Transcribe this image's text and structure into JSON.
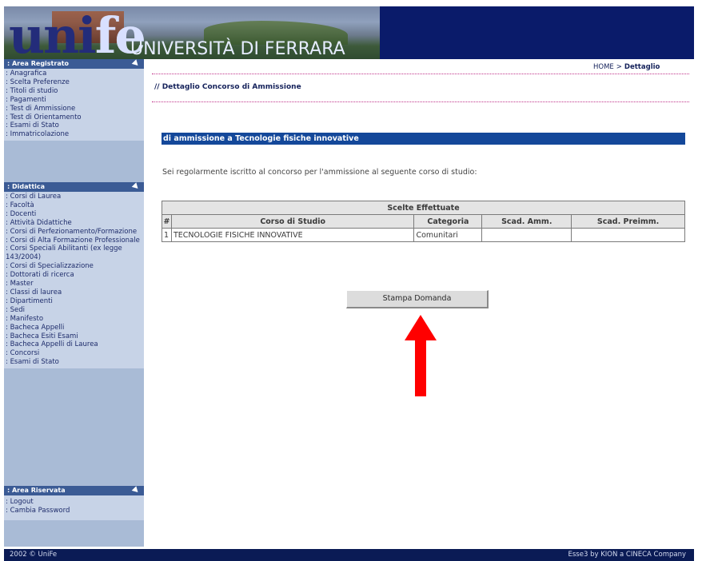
{
  "header": {
    "logo_text_a": "uni",
    "logo_text_b": "fe",
    "university_name": "UNIVERSITÀ DI FERRARA"
  },
  "sidebar": {
    "sections": [
      {
        "title": ": Area Registrato",
        "items": [
          ": Anagrafica",
          ": Scelta Preferenze",
          ": Titoli di studio",
          ": Pagamenti",
          ": Test di Ammissione",
          ": Test di Orientamento",
          ": Esami di Stato",
          ": Immatricolazione"
        ]
      },
      {
        "title": ": Didattica",
        "items": [
          ": Corsi di Laurea",
          ": Facoltà",
          ": Docenti",
          ": Attività Didattiche",
          ": Corsi di Perfezionamento/Formazione",
          ": Corsi di Alta Formazione Professionale",
          ": Corsi Speciali Abilitanti (ex legge 143/2004)",
          ": Corsi di Specializzazione",
          ": Dottorati di ricerca",
          ": Master",
          ": Classi di laurea",
          ": Dipartimenti",
          ": Sedi",
          ": Manifesto",
          ": Bacheca Appelli",
          ": Bacheca Esiti Esami",
          ": Bacheca Appelli di Laurea",
          ": Concorsi",
          ": Esami di Stato"
        ]
      },
      {
        "title": ": Area Riservata",
        "items": [
          ": Logout",
          ": Cambia Password"
        ]
      }
    ]
  },
  "breadcrumb": {
    "home": "HOME",
    "separator": ">",
    "current": "Dettaglio"
  },
  "page_title": "// Dettaglio Concorso di Ammissione",
  "section_bar": "di ammissione a Tecnologie fisiche innovative",
  "intro_text": "Sei regolarmente iscritto al concorso per l'ammissione al seguente corso di studio:",
  "table": {
    "caption": "Scelte Effettuate",
    "headers": [
      "#",
      "Corso di Studio",
      "Categoria",
      "Scad. Amm.",
      "Scad. Preimm."
    ],
    "rows": [
      [
        "1",
        "TECNOLOGIE FISICHE INNOVATIVE",
        "Comunitari",
        "",
        ""
      ]
    ]
  },
  "print_button": "Stampa Domanda",
  "footer": {
    "copyright": "2002 © UniFe",
    "credit": "Esse3 by KION a CINECA Company"
  },
  "colors": {
    "header_bg": "#0a1b6a",
    "sidebar_bg": "#c7d3e7",
    "sidebar_head": "#3b5b95",
    "section_bar": "#14489a",
    "arrow": "#ff0000"
  }
}
